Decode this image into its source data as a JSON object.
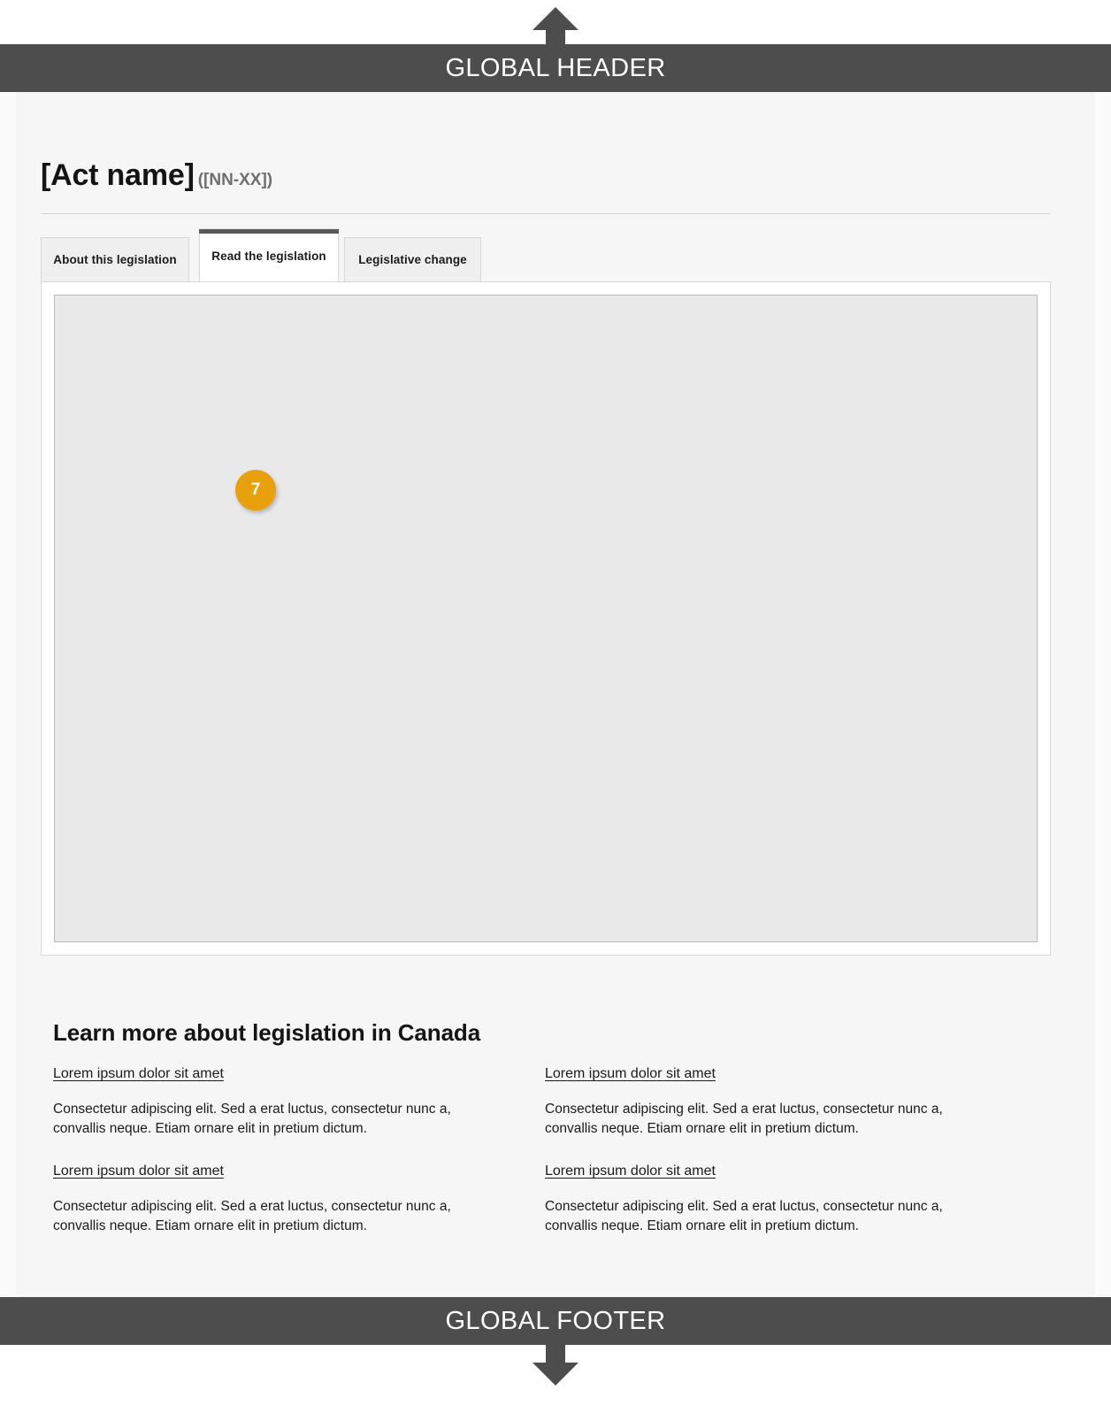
{
  "header": {
    "label": "GLOBAL HEADER",
    "arrow_icon": "arrow-up-icon"
  },
  "footer": {
    "label": "GLOBAL FOOTER",
    "arrow_icon": "arrow-down-icon"
  },
  "title": {
    "act_name": "[Act name]",
    "act_code": "([NN-XX])"
  },
  "tabs": [
    {
      "label": "About this legislation",
      "active": false
    },
    {
      "label": "Read the legislation",
      "active": true
    },
    {
      "label": "Legislative change",
      "active": false
    }
  ],
  "panel": {
    "badge": {
      "number": "7",
      "color": "#e8a00d"
    }
  },
  "learn_more": {
    "heading": "Learn more about legislation in Canada",
    "items": [
      {
        "link": "Lorem ipsum dolor sit amet",
        "body": "Consectetur adipiscing elit. Sed a erat luctus, consectetur nunc a, convallis neque. Etiam ornare elit in pretium dictum."
      },
      {
        "link": "Lorem ipsum dolor sit amet",
        "body": "Consectetur adipiscing elit. Sed a erat luctus, consectetur nunc a, convallis neque. Etiam ornare elit in pretium dictum."
      },
      {
        "link": "Lorem ipsum dolor sit amet",
        "body": "Consectetur adipiscing elit. Sed a erat luctus, consectetur nunc a, convallis neque. Etiam ornare elit in pretium dictum."
      },
      {
        "link": "Lorem ipsum dolor sit amet",
        "body": "Consectetur adipiscing elit. Sed a erat luctus, consectetur nunc a, convallis neque. Etiam ornare elit in pretium dictum."
      }
    ]
  },
  "colors": {
    "bar": "#4d4d4d",
    "accent": "#e8a00d",
    "page_bg": "#f6f6f6",
    "placeholder": "#e9e9e9"
  }
}
